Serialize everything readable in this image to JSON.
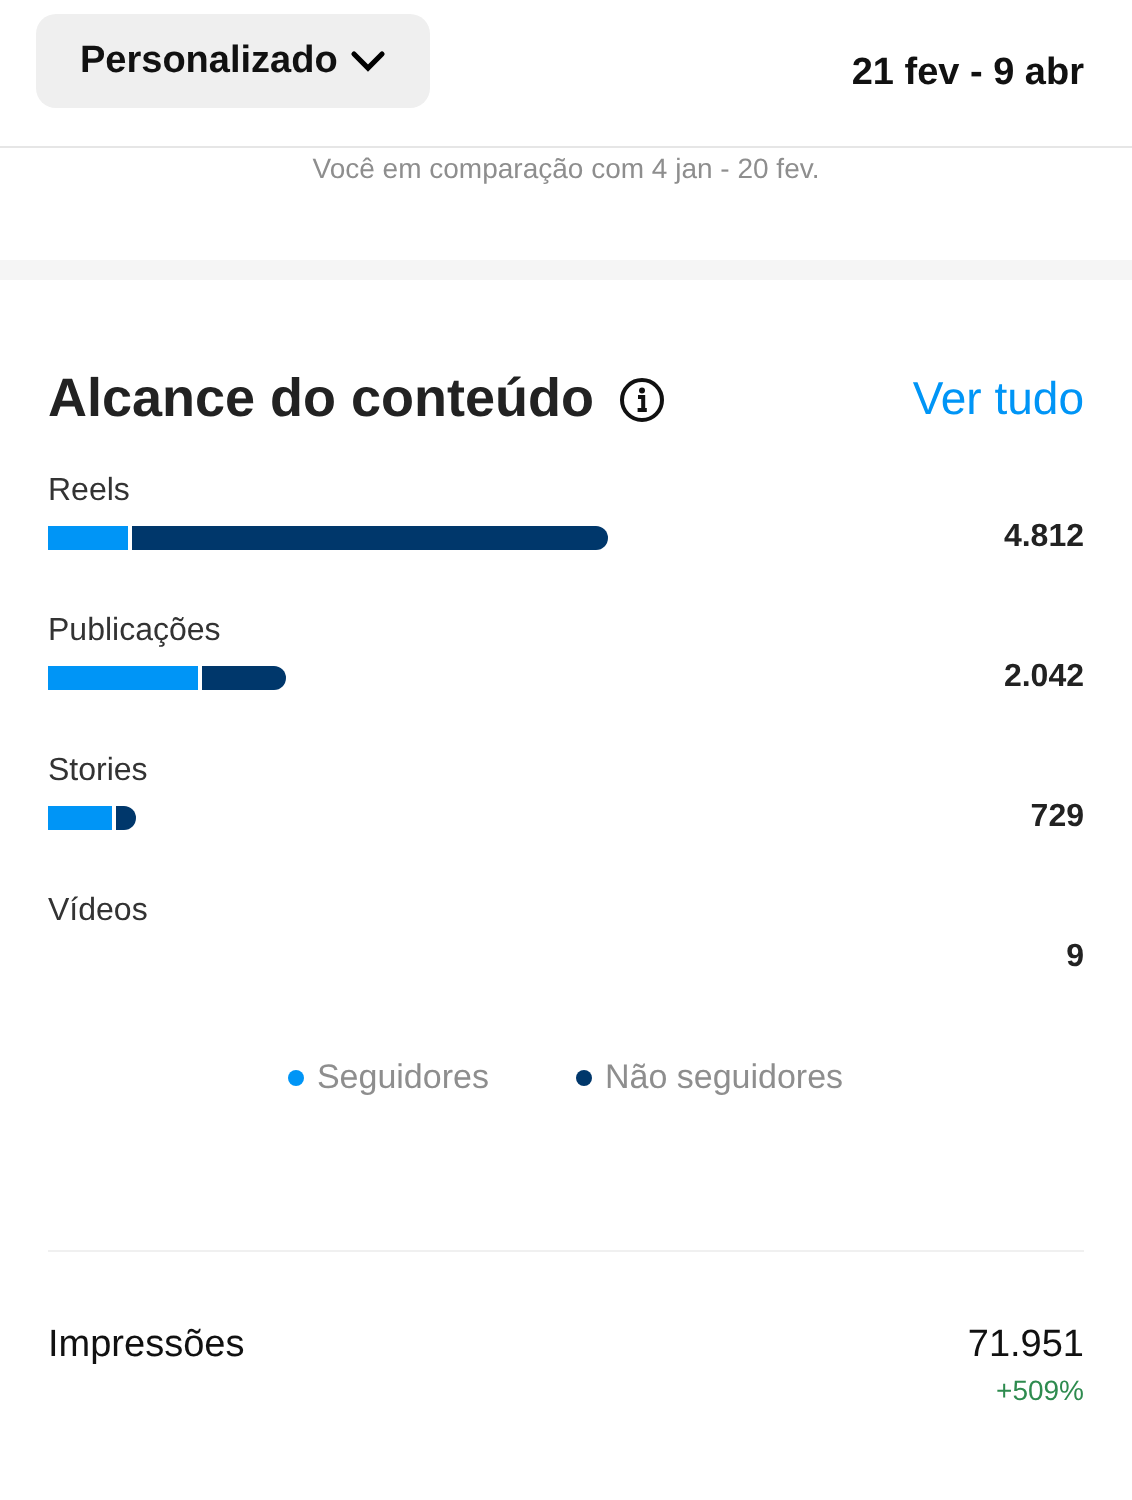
{
  "header": {
    "period_button": "Personalizado",
    "date_range": "21 fev - 9 abr"
  },
  "comparison_note": "Você em comparação com 4 jan - 20 fev.",
  "content_reach": {
    "title": "Alcance do conteúdo",
    "see_all": "Ver tudo",
    "rows": [
      {
        "label": "Reels",
        "value": "4.812"
      },
      {
        "label": "Publicações",
        "value": "2.042"
      },
      {
        "label": "Stories",
        "value": "729"
      },
      {
        "label": "Vídeos",
        "value": "9"
      }
    ],
    "legend": [
      {
        "kind": "followers",
        "label": "Seguidores",
        "color": "#0095f6"
      },
      {
        "kind": "non_followers",
        "label": "Não seguidores",
        "color": "#00376b"
      }
    ]
  },
  "impressions": {
    "label": "Impressões",
    "value": "71.951",
    "change": "+509%"
  }
}
